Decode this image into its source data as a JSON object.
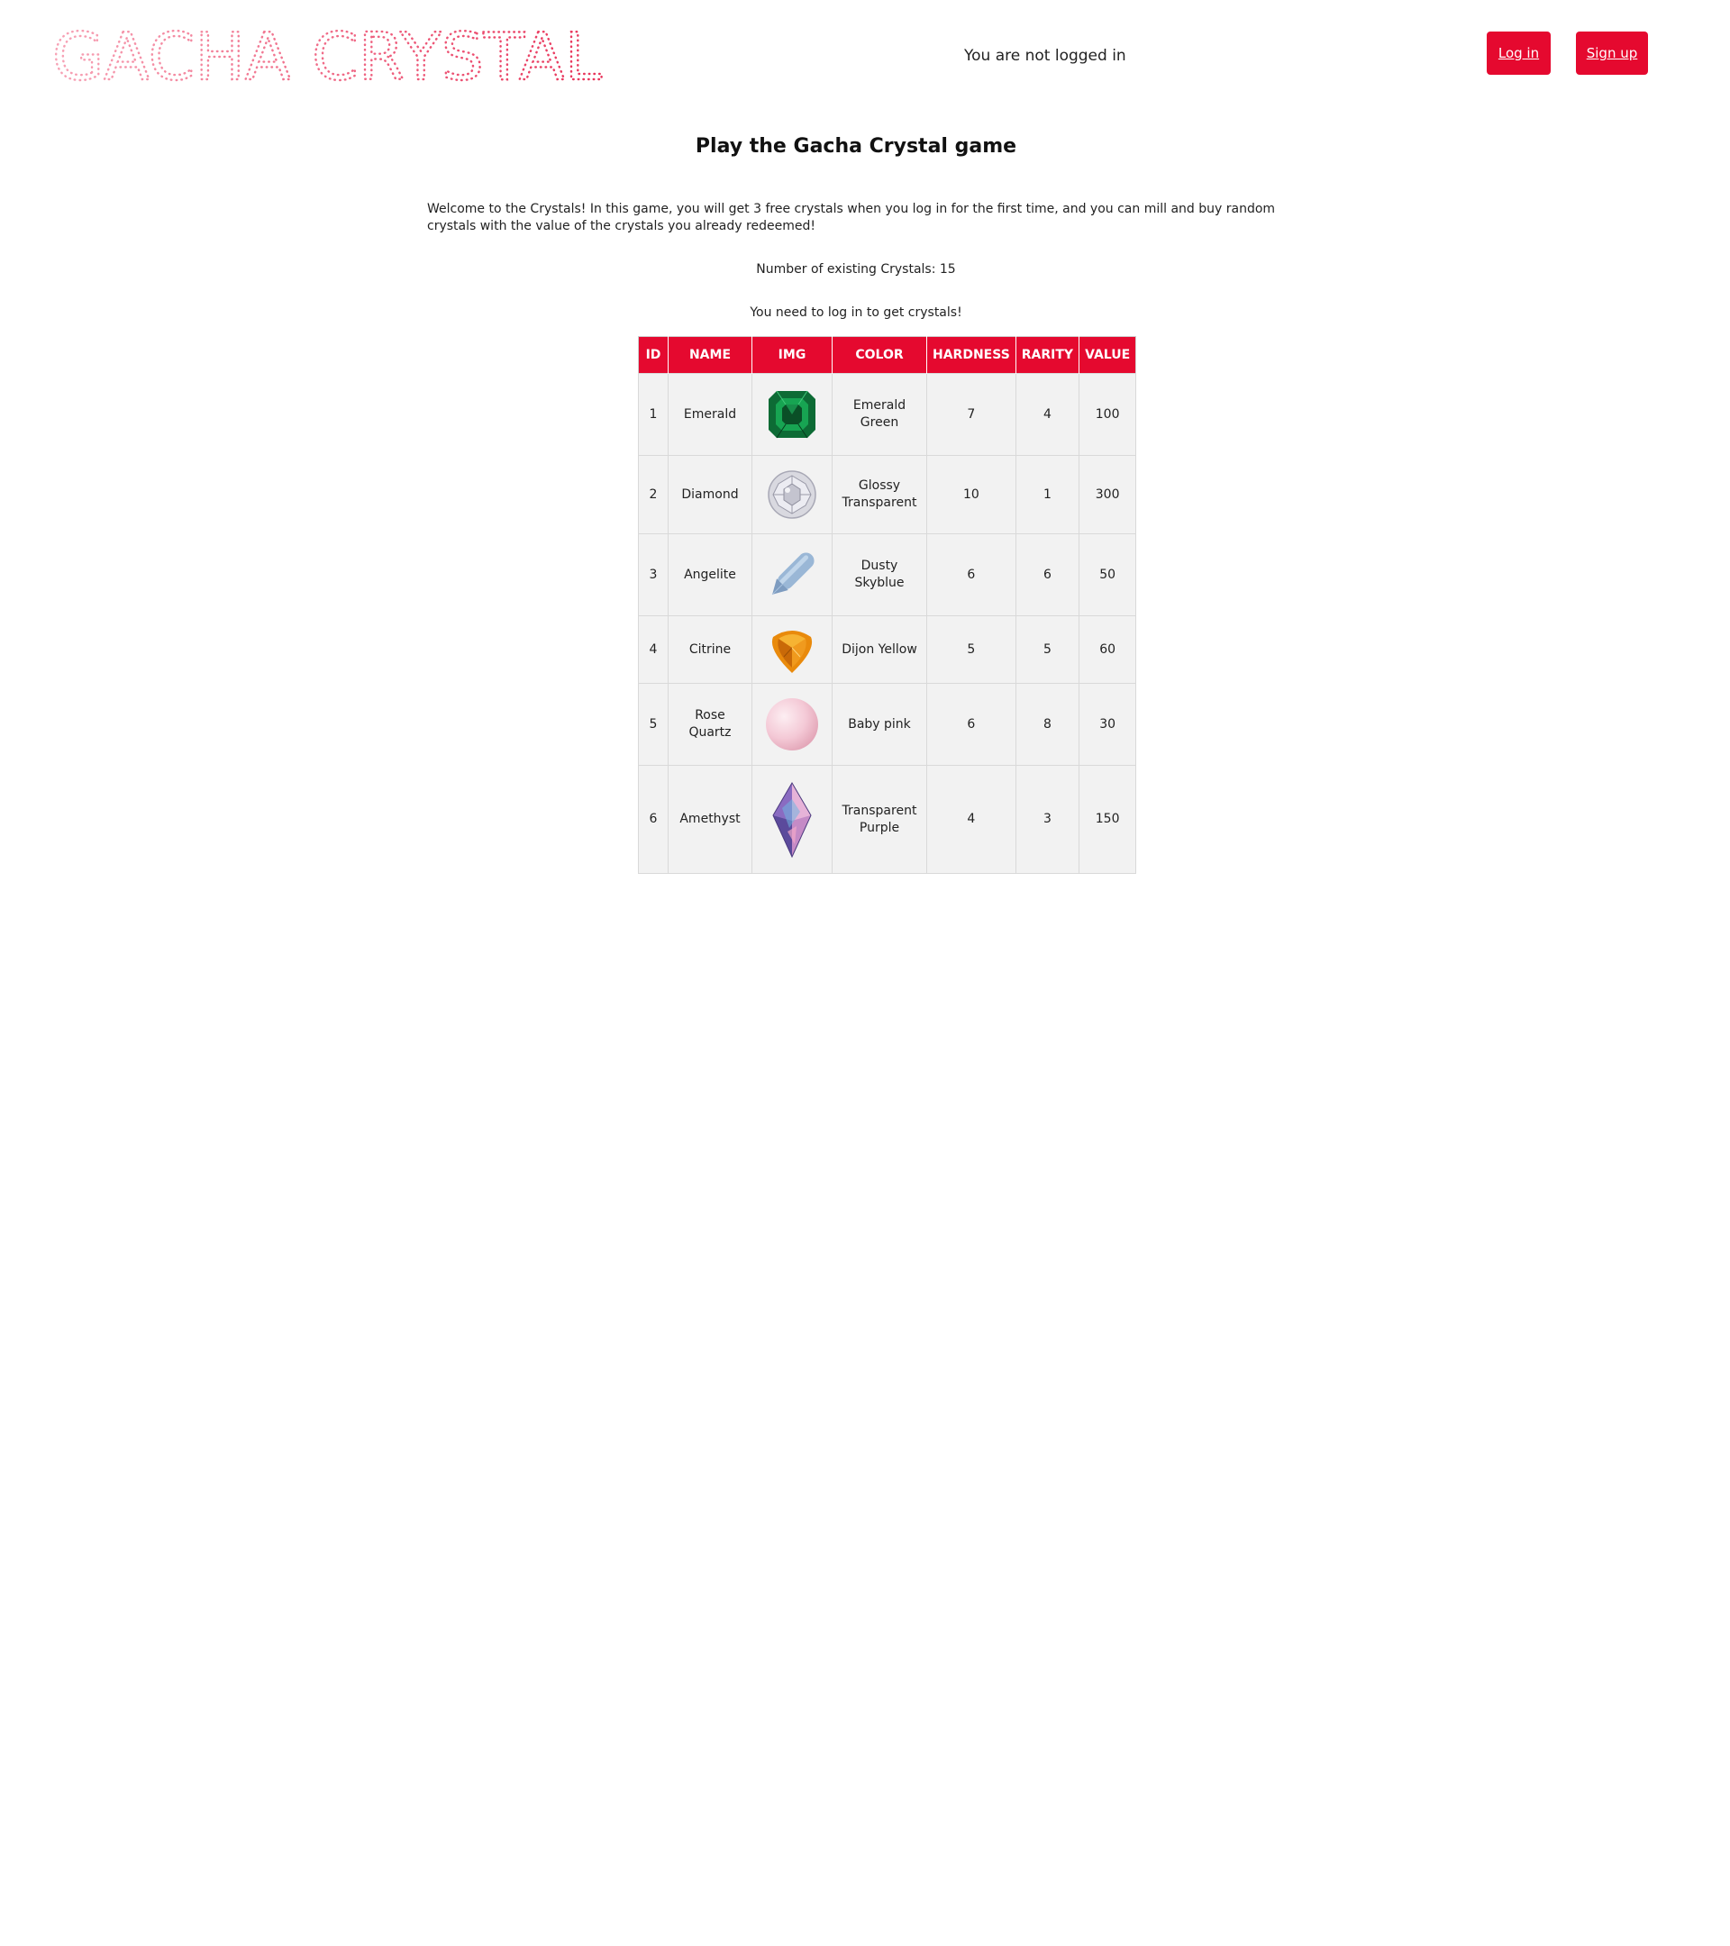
{
  "header": {
    "logo_text": "GACHA CRYSTAL",
    "login_status": "You are not logged in",
    "login_label": "Log in",
    "signup_label": "Sign up"
  },
  "main": {
    "title": "Play the Gacha Crystal game",
    "welcome": "Welcome to the Crystals! In this game, you will get 3 free crystals when you log in for the first time, and you can mill and buy random crystals with the value of the crystals you already redeemed!",
    "count_line": "Number of existing Crystals: 15",
    "login_hint": "You need to log in to get crystals!"
  },
  "table": {
    "headers": [
      "ID",
      "NAME",
      "IMG",
      "COLOR",
      "HARDNESS",
      "RARITY",
      "VALUE"
    ],
    "rows": [
      {
        "id": "1",
        "name": "Emerald",
        "icon": "emerald-gem-icon",
        "color": "Emerald Green",
        "hardness": "7",
        "rarity": "4",
        "value": "100"
      },
      {
        "id": "2",
        "name": "Diamond",
        "icon": "diamond-gem-icon",
        "color": "Glossy Transparent",
        "hardness": "10",
        "rarity": "1",
        "value": "300"
      },
      {
        "id": "3",
        "name": "Angelite",
        "icon": "angelite-crystal-icon",
        "color": "Dusty Skyblue",
        "hardness": "6",
        "rarity": "6",
        "value": "50"
      },
      {
        "id": "4",
        "name": "Citrine",
        "icon": "citrine-gem-icon",
        "color": "Dijon Yellow",
        "hardness": "5",
        "rarity": "5",
        "value": "60"
      },
      {
        "id": "5",
        "name": "Rose Quartz",
        "icon": "rose-quartz-sphere-icon",
        "color": "Baby pink",
        "hardness": "6",
        "rarity": "8",
        "value": "30"
      },
      {
        "id": "6",
        "name": "Amethyst",
        "icon": "amethyst-crystal-icon",
        "color": "Transparent Purple",
        "hardness": "4",
        "rarity": "3",
        "value": "150"
      }
    ]
  },
  "colors": {
    "accent": "#e5092f",
    "logo_pink": "#f06a8a",
    "row_bg": "#f2f2f2"
  }
}
